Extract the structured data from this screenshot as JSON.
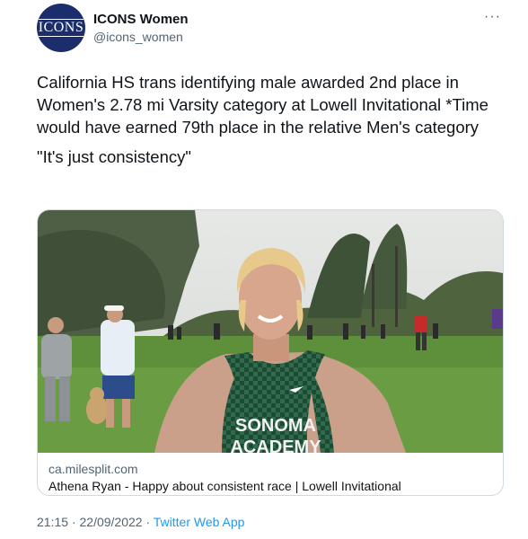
{
  "header": {
    "display_name": "ICONS Women",
    "handle": "@icons_women",
    "avatar_text": "ICONS",
    "more_label": "···"
  },
  "tweet": {
    "text": "California HS trans identifying male awarded 2nd place in Women's 2.78 mi Varsity category at Lowell Invitational *Time would have earned 79th place in the relative Men's category",
    "quote": "\"It's just consistency\""
  },
  "card": {
    "domain": "ca.milesplit.com",
    "title": "Athena Ryan - Happy about consistent race | Lowell Invitational",
    "jersey_text_line1": "SONOMA",
    "jersey_text_line2": "ACADEMY"
  },
  "meta": {
    "time": "21:15",
    "date": "22/09/2022",
    "separator": "·",
    "source": "Twitter Web App"
  },
  "colors": {
    "accent": "#1d9bf0",
    "avatar_bg": "#1b2d6b",
    "jersey": "#1e4a34"
  }
}
